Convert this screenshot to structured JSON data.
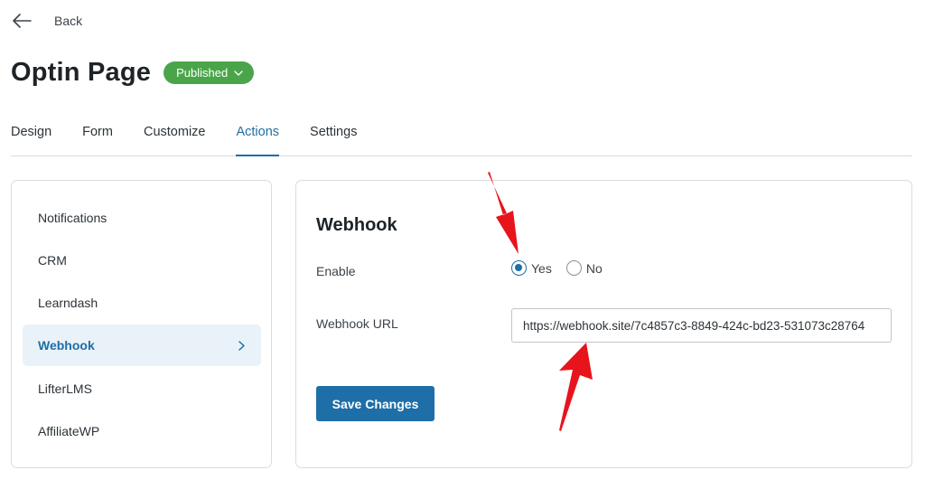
{
  "header": {
    "back_label": "Back",
    "page_title": "Optin Page",
    "status": "Published"
  },
  "tabs": [
    {
      "label": "Design",
      "active": false
    },
    {
      "label": "Form",
      "active": false
    },
    {
      "label": "Customize",
      "active": false
    },
    {
      "label": "Actions",
      "active": true
    },
    {
      "label": "Settings",
      "active": false
    }
  ],
  "sidebar": {
    "items": [
      {
        "label": "Notifications",
        "active": false
      },
      {
        "label": "CRM",
        "active": false
      },
      {
        "label": "Learndash",
        "active": false
      },
      {
        "label": "Webhook",
        "active": true
      },
      {
        "label": "LifterLMS",
        "active": false
      },
      {
        "label": "AffiliateWP",
        "active": false
      }
    ]
  },
  "panel": {
    "title": "Webhook",
    "enable_label": "Enable",
    "enable_options": [
      {
        "label": "Yes",
        "checked": true
      },
      {
        "label": "No",
        "checked": false
      }
    ],
    "url_label": "Webhook URL",
    "url_value": "https://webhook.site/7c4857c3-8849-424c-bd23-531073c28764",
    "save_label": "Save Changes"
  },
  "colors": {
    "accent": "#1e6ea7",
    "badge": "#4aa54a",
    "annotation_arrow": "#e8141b",
    "active_item_bg": "#e9f2f8"
  },
  "icons": [
    "back-arrow-icon",
    "chevron-down-icon",
    "chevron-right-icon"
  ]
}
